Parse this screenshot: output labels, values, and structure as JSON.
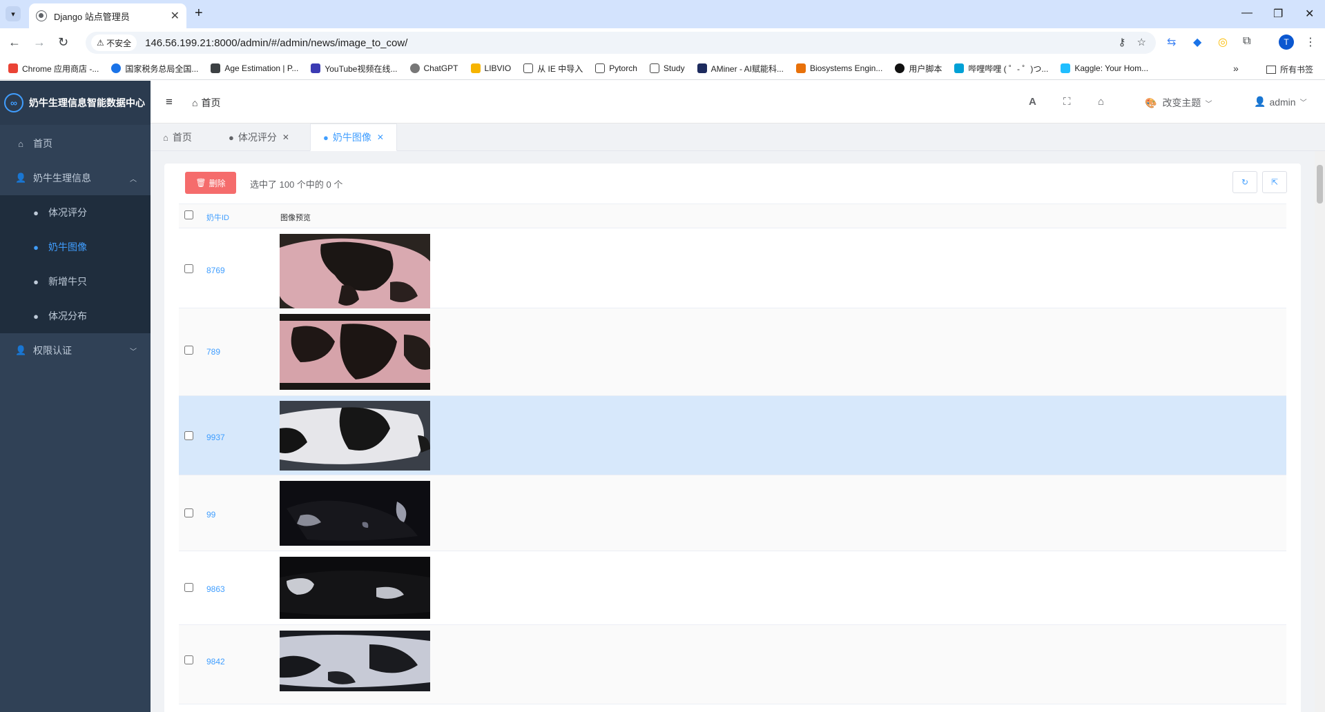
{
  "browser": {
    "tab_title": "Django 站点管理员",
    "security_label": "不安全",
    "url": "146.56.199.21:8000/admin/#/admin/news/image_to_cow/",
    "profile_initial": "T",
    "bookmarks": [
      "Chrome 应用商店 -...",
      "国家税务总局全国...",
      "Age Estimation | P...",
      "YouTube视频在线...",
      "ChatGPT",
      "LIBVIO",
      "从 IE 中导入",
      "Pytorch",
      "Study",
      "AMiner - AI赋能科...",
      "Biosystems Engin...",
      "用户脚本",
      "哔哩哔哩 ( ゜- ゜)つ...",
      "Kaggle: Your Hom..."
    ],
    "all_bookmarks": "所有书签"
  },
  "sidebar": {
    "brand": "奶牛生理信息智能数据中心",
    "home": "首页",
    "group1": "奶牛生理信息",
    "sub_items": [
      "体况评分",
      "奶牛图像",
      "新增牛只",
      "体况分布"
    ],
    "group2": "权限认证"
  },
  "topbar": {
    "breadcrumb": "首页",
    "theme_label": "改变主题",
    "user": "admin"
  },
  "tabs": [
    "首页",
    "体况评分",
    "奶牛图像"
  ],
  "toolbar": {
    "delete_label": "删除",
    "selection_info": "选中了 100 个中的 0 个"
  },
  "table": {
    "col_id": "奶牛ID",
    "col_preview": "图像预览",
    "rows": [
      {
        "id": "8769"
      },
      {
        "id": "789"
      },
      {
        "id": "9937"
      },
      {
        "id": "99"
      },
      {
        "id": "9863"
      },
      {
        "id": "9842"
      }
    ]
  },
  "colors": {
    "accent": "#409eff",
    "danger": "#f56c6c",
    "sidebar": "#304156",
    "row_highlight": "#d7e8fb"
  }
}
